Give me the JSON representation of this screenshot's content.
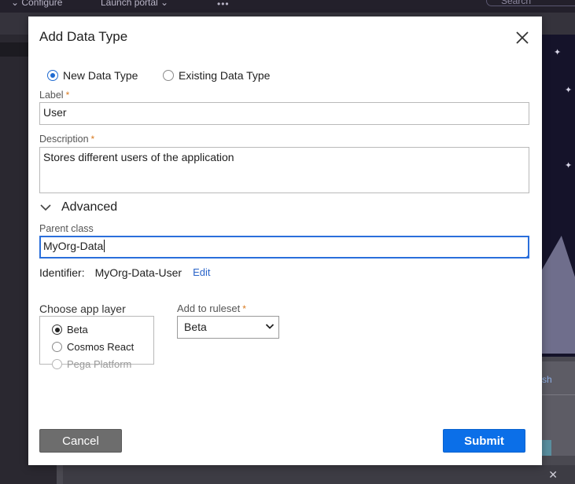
{
  "background": {
    "nav_configure": "⌄  Configure",
    "nav_launch": "Launch portal  ⌄",
    "nav_more": "•••",
    "search_placeholder": "Search",
    "card_link": "sh",
    "close_glyph": "✕"
  },
  "modal": {
    "title": "Add Data Type",
    "type_options": [
      {
        "label": "New Data Type",
        "selected": true
      },
      {
        "label": "Existing Data Type",
        "selected": false
      }
    ],
    "label_field": {
      "label": "Label",
      "value": "User",
      "required": "*"
    },
    "description_field": {
      "label": "Description",
      "value": "Stores different users of the application",
      "required": "*"
    },
    "advanced": {
      "label": "Advanced",
      "expanded": true
    },
    "parent_class": {
      "label": "Parent class",
      "value": "MyOrg-Data"
    },
    "identifier": {
      "label": "Identifier:",
      "value": "MyOrg-Data-User",
      "edit_label": "Edit"
    },
    "app_layer": {
      "label": "Choose app layer",
      "options": [
        {
          "label": "Beta",
          "selected": true,
          "disabled": false
        },
        {
          "label": "Cosmos React",
          "selected": false,
          "disabled": false
        },
        {
          "label": "Pega Platform",
          "selected": false,
          "disabled": true
        }
      ]
    },
    "ruleset": {
      "label": "Add to ruleset",
      "required": "*",
      "value": "Beta"
    },
    "buttons": {
      "cancel": "Cancel",
      "submit": "Submit"
    }
  },
  "colors": {
    "accent": "#0b6fe8",
    "required": "#d97a1f",
    "link": "#2a64c9",
    "cancel": "#6d6d6d"
  }
}
